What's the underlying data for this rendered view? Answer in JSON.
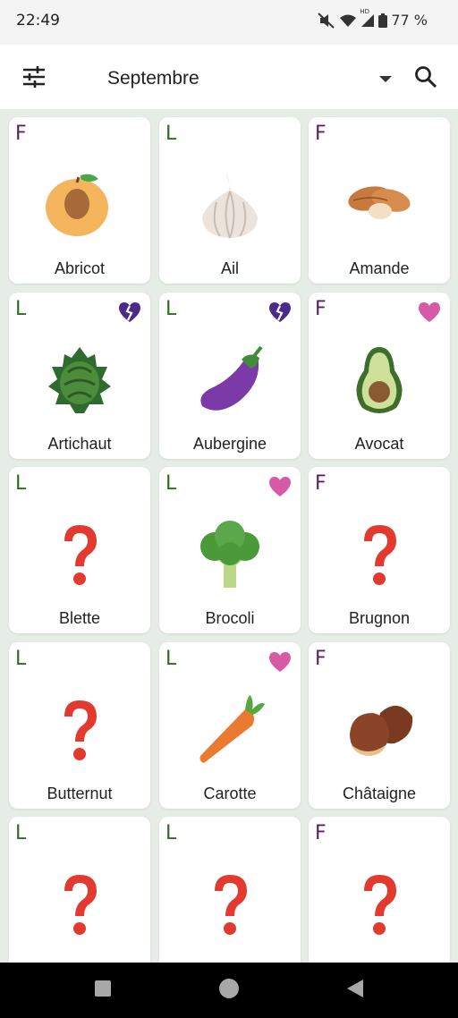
{
  "status": {
    "time": "22:49",
    "battery_text": "77 %",
    "network_badge": "HD"
  },
  "app_bar": {
    "month": "Septembre",
    "filter_icon": "tune-icon",
    "search_icon": "search-icon"
  },
  "colors": {
    "fruit_badge": "#5a1e63",
    "vegetable_badge": "#2c6e20",
    "heart": "#d65aa5",
    "broken_heart": "#4a2a8a",
    "grid_bg": "#e6ede6"
  },
  "cards": [
    {
      "name": "Abricot",
      "type": "F",
      "heart": "none",
      "icon": "apricot-icon"
    },
    {
      "name": "Ail",
      "type": "L",
      "heart": "none",
      "icon": "garlic-icon"
    },
    {
      "name": "Amande",
      "type": "F",
      "heart": "none",
      "icon": "almond-icon"
    },
    {
      "name": "Artichaut",
      "type": "L",
      "heart": "broken",
      "icon": "artichoke-icon"
    },
    {
      "name": "Aubergine",
      "type": "L",
      "heart": "broken",
      "icon": "eggplant-icon"
    },
    {
      "name": "Avocat",
      "type": "F",
      "heart": "pink",
      "icon": "avocado-icon"
    },
    {
      "name": "Blette",
      "type": "L",
      "heart": "none",
      "icon": "question-icon"
    },
    {
      "name": "Brocoli",
      "type": "L",
      "heart": "pink",
      "icon": "broccoli-icon"
    },
    {
      "name": "Brugnon",
      "type": "F",
      "heart": "none",
      "icon": "question-icon"
    },
    {
      "name": "Butternut",
      "type": "L",
      "heart": "none",
      "icon": "question-icon"
    },
    {
      "name": "Carotte",
      "type": "L",
      "heart": "pink",
      "icon": "carrot-icon"
    },
    {
      "name": "Châtaigne",
      "type": "F",
      "heart": "none",
      "icon": "chestnut-icon"
    },
    {
      "name": "",
      "type": "L",
      "heart": "none",
      "icon": "question-icon"
    },
    {
      "name": "",
      "type": "L",
      "heart": "none",
      "icon": "question-icon"
    },
    {
      "name": "",
      "type": "F",
      "heart": "none",
      "icon": "question-icon"
    }
  ],
  "nav": {
    "recents_icon": "recents-icon",
    "home_icon": "home-icon",
    "back_icon": "back-icon"
  }
}
